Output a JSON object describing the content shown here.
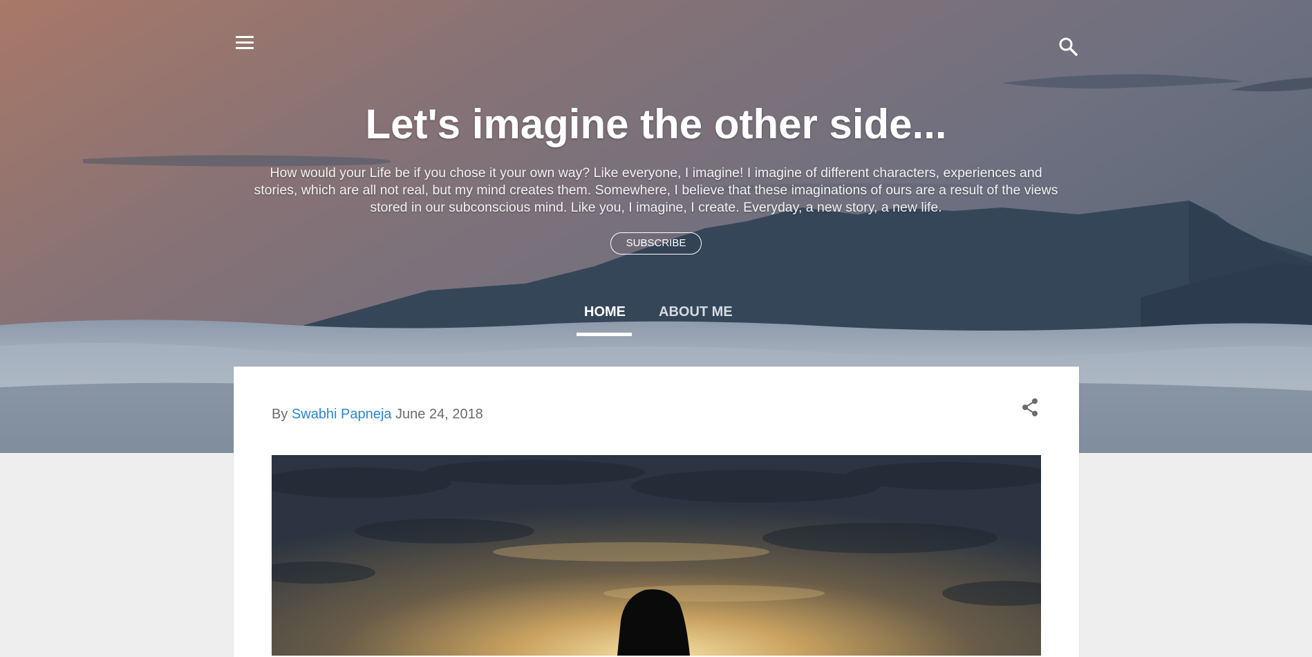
{
  "header": {
    "menu_icon": "hamburger-menu-icon",
    "search_icon": "search-icon",
    "title": "Let's imagine the other side...",
    "description": "How would your Life be if you chose it your own way? Like everyone, I imagine! I imagine of different characters, experiences and stories, which are all not real, but my mind creates them. Somewhere, I believe that these imaginations of  ours are a result of the views stored in our subconscious mind. Like you, I imagine, I create. Everyday, a new story, a new life.",
    "subscribe_label": "SUBSCRIBE"
  },
  "nav": {
    "tabs": [
      {
        "label": "HOME",
        "active": true
      },
      {
        "label": "ABOUT ME",
        "active": false
      }
    ]
  },
  "post": {
    "by_label": "By",
    "author": "Swabhi Papneja",
    "date": "June 24, 2018",
    "share_icon": "share-icon"
  },
  "colors": {
    "accent_link": "#2a86d6",
    "page_background": "#eeeeee",
    "card_background": "#ffffff"
  }
}
